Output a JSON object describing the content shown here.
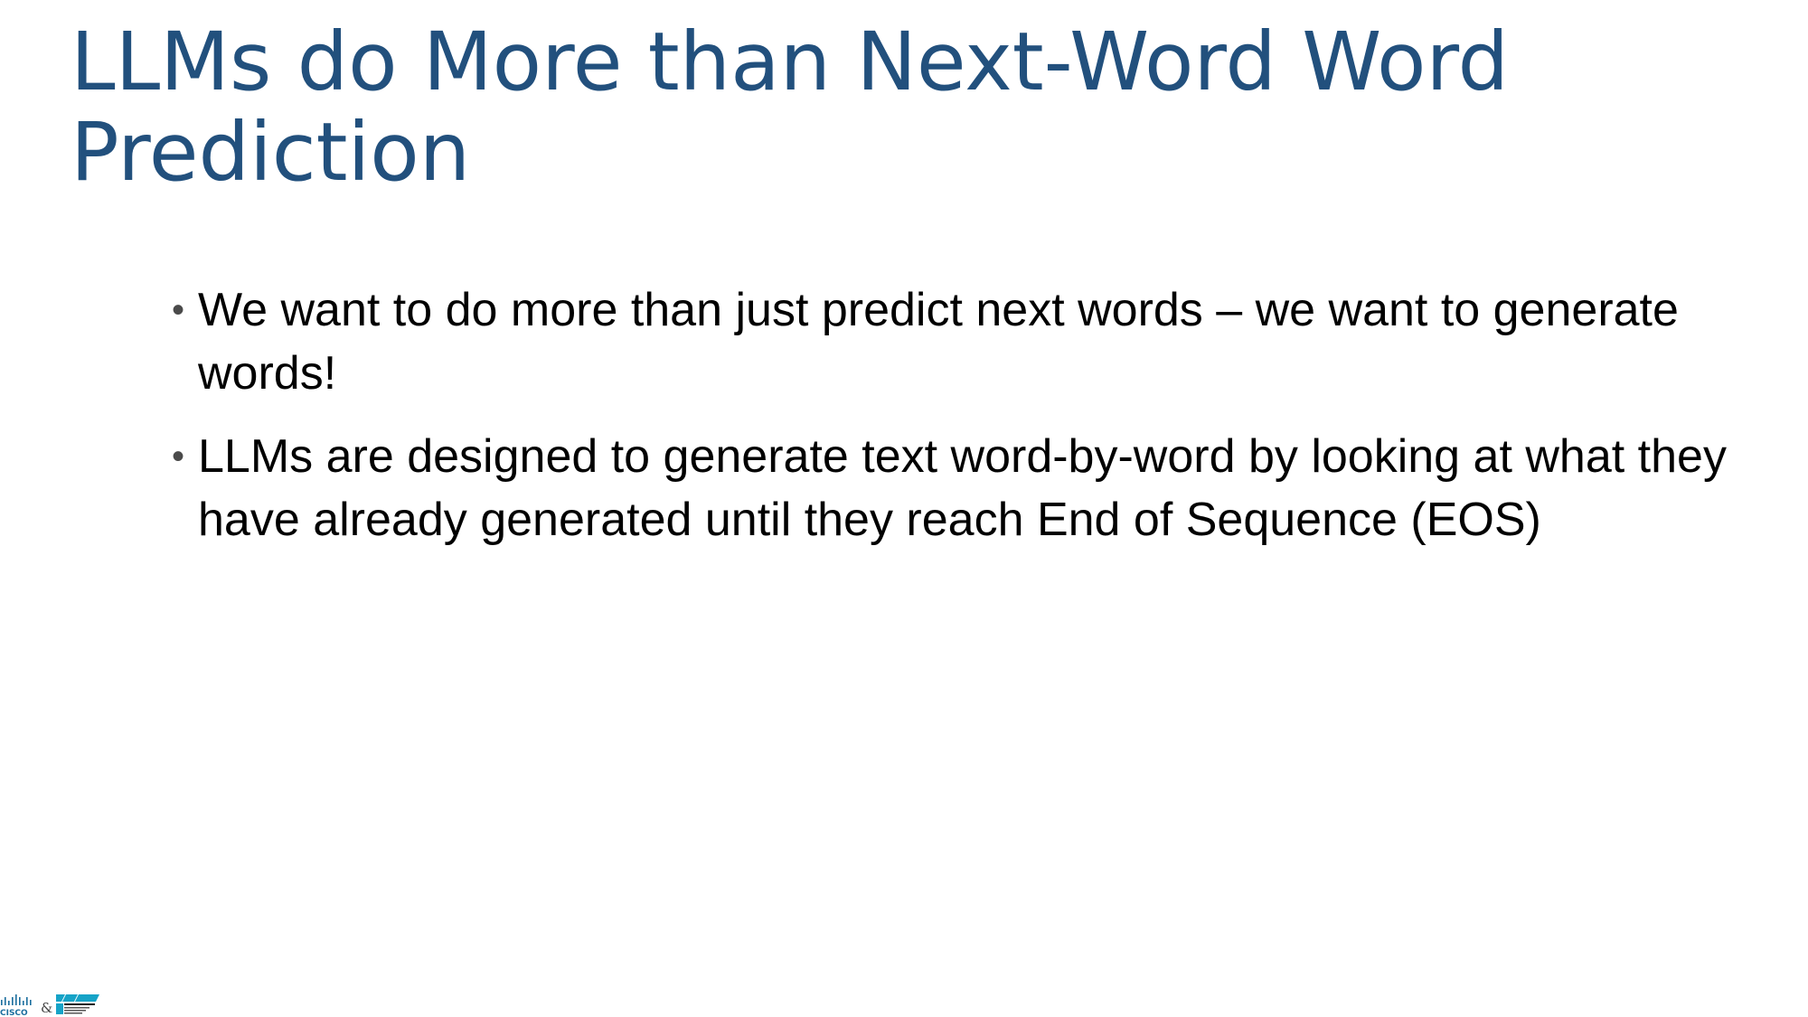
{
  "slide": {
    "title": "LLMs do More than Next-Word Word Prediction",
    "bullets": [
      {
        "text": "We want to do more than just predict next words – we want to generate words!"
      },
      {
        "text": "LLMs are designed to generate text word-by-word by looking at what they have already generated until they reach End of Sequence (EOS)"
      }
    ],
    "bullet_glyph": "•",
    "title_color": "#22507d"
  },
  "footer_logo": {
    "left_brand": "CISCO",
    "separator": "&",
    "right_brand": "IMT Atlantique",
    "icon_names": [
      "cisco-logo-icon",
      "imt-atlantique-logo-icon"
    ],
    "colors": {
      "cisco": "#1b6e9e",
      "imt": "#16a3c7"
    }
  }
}
